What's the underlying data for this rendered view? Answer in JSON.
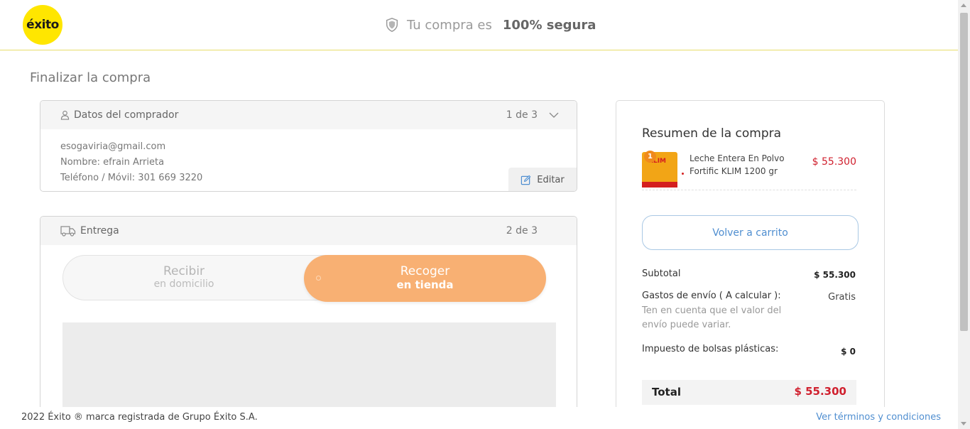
{
  "header": {
    "logo_text": "éxito",
    "secure_prefix": "Tu compra es",
    "secure_strong": "100% segura",
    "brand_color": "#ffe600"
  },
  "page_title": "Finalizar la compra",
  "buyer": {
    "title": "Datos del comprador",
    "step": "1 de 3",
    "email": "esogaviria@gmail.com",
    "name": "Nombre: efrain Arrieta",
    "phone": "Teléfono / Móvil: 301 669 3220",
    "edit_label": "Editar"
  },
  "delivery": {
    "title": "Entrega",
    "step": "2 de 3",
    "option_home_l1": "Recibir",
    "option_home_l2": "en domicilio",
    "option_store_l1": "Recoger",
    "option_store_l2": "en tienda",
    "active_color": "#f8b073"
  },
  "summary": {
    "title": "Resumen de la compra",
    "product": {
      "quantity": "1",
      "name": "Leche Entera En Polvo Fortific KLIM 1200 gr",
      "image_label": "KLIM",
      "price": "$ 55.300"
    },
    "back_button": "Volver a carrito",
    "subtotal_label": "Subtotal",
    "subtotal_value": "$ 55.300",
    "shipping_label": "Gastos de envío ( A calcular ):",
    "shipping_value": "Gratis",
    "shipping_note": "Ten en cuenta que el valor del envío puede variar.",
    "bags_label": "Impuesto de bolsas plásticas:",
    "bags_value": "$ 0",
    "total_label": "Total",
    "total_value": "$ 55.300",
    "price_color": "#d0202e"
  },
  "footer": {
    "copyright": "2022 Éxito ® marca registrada de Grupo Éxito S.A.",
    "terms": "Ver términos y condiciones"
  }
}
